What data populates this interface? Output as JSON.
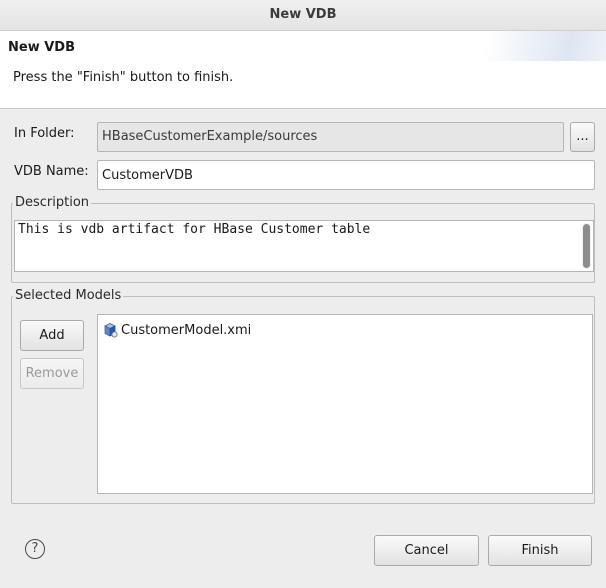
{
  "window": {
    "title": "New VDB"
  },
  "banner": {
    "title": "New VDB",
    "message": "Press the \"Finish\" button to finish."
  },
  "form": {
    "folder_label": "In Folder:",
    "folder_value": "HBaseCustomerExample/sources",
    "browse_label": "...",
    "vdb_name_label": "VDB Name:",
    "vdb_name_value": "CustomerVDB"
  },
  "description": {
    "label": "Description",
    "text": "This is vdb artifact for HBase Customer table"
  },
  "models": {
    "label": "Selected Models",
    "add_label": "Add",
    "remove_label": "Remove",
    "items": [
      {
        "name": "CustomerModel.xmi",
        "icon": "model-file-icon"
      }
    ]
  },
  "footer": {
    "help_glyph": "?",
    "cancel_label": "Cancel",
    "finish_label": "Finish"
  },
  "colors": {
    "dialog_bg": "#ededed",
    "banner_bg": "#ffffff",
    "model_icon": "#4a78c2"
  }
}
